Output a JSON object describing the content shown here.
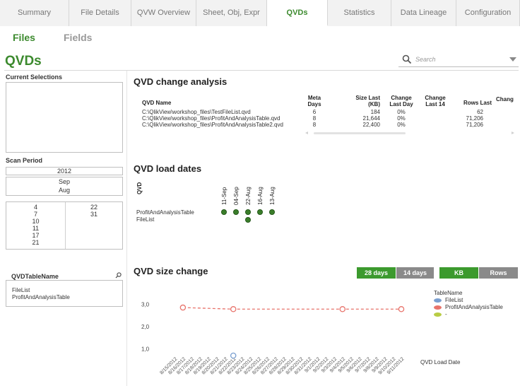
{
  "tabs": [
    {
      "label": "Summary",
      "active": false
    },
    {
      "label": "File Details",
      "active": false
    },
    {
      "label": "QVW Overview",
      "active": false
    },
    {
      "label": "Sheet, Obj, Expr",
      "active": false
    },
    {
      "label": "QVDs",
      "active": true
    },
    {
      "label": "Statistics",
      "active": false
    },
    {
      "label": "Data Lineage",
      "active": false
    },
    {
      "label": "Configuration",
      "active": false
    }
  ],
  "subtabs": [
    {
      "label": "Files",
      "active": true
    },
    {
      "label": "Fields",
      "active": false
    }
  ],
  "page_title": "QVDs",
  "search": {
    "placeholder": "Search",
    "icon": "search-icon"
  },
  "left": {
    "current_selections_label": "Current Selections",
    "scan_period_label": "Scan Period",
    "year": "2012",
    "months": [
      "Sep",
      "Aug"
    ],
    "days_col1": [
      "4",
      "7",
      "10",
      "11",
      "17",
      "21"
    ],
    "days_col2": [
      "22",
      "31"
    ],
    "qvd_table_label": "QVDTableName",
    "qvd_tables": [
      "FileList",
      "ProfitAndAnalysisTable"
    ]
  },
  "change_analysis": {
    "title": "QVD change analysis",
    "headers": {
      "name": "QVD Name",
      "meta_days": "Meta Days",
      "size_last": "Size Last (KB)",
      "change_last_day": "Change Last Day",
      "change_last_14": "Change Last 14",
      "rows_last": "Rows Last",
      "change": "Chang"
    },
    "rows": [
      {
        "name": "C:\\QlikView\\workshop_files\\TestFileList.qvd",
        "meta": "6",
        "size": "184",
        "chg": "0%",
        "rows": "62"
      },
      {
        "name": "C:\\QlikView\\workshop_files\\ProfitAndAnalysisTable.qvd",
        "meta": "8",
        "size": "21,644",
        "chg": "0%",
        "rows": "71,206"
      },
      {
        "name": "C:\\QlikView\\workshop_files\\ProfitAndAnalysisTable2.qvd",
        "meta": "8",
        "size": "22,400",
        "chg": "0%",
        "rows": "71,206"
      }
    ]
  },
  "load_dates": {
    "title": "QVD load dates",
    "qvd_label": "QVD",
    "dates": [
      "11-Sep",
      "04-Sep",
      "22-Aug",
      "16-Aug",
      "13-Aug"
    ],
    "rows": [
      {
        "name": "ProfitAndAnalysisTable",
        "loaded": [
          true,
          true,
          true,
          true,
          true
        ]
      },
      {
        "name": "FileList",
        "loaded": [
          false,
          false,
          true,
          false,
          false
        ]
      }
    ],
    "dot_color": "#3a7d2a"
  },
  "size_change": {
    "title": "QVD size change",
    "buttons": {
      "days28": "28 days",
      "days14": "14 days",
      "kb": "KB",
      "rows": "Rows"
    },
    "legend_title": "TableName",
    "legend": [
      {
        "name": "FileList",
        "color": "#7a9fd0"
      },
      {
        "name": "ProfitAndAnalysisTable",
        "color": "#e8736b"
      },
      {
        "name": "-",
        "color": "#b8cc44"
      }
    ],
    "x_axis_label": "QVD Load Date"
  },
  "chart_data": {
    "type": "line",
    "x": [
      "8/15/2012",
      "8/16/2012",
      "8/17/2012",
      "8/18/2012",
      "8/19/2012",
      "8/20/2012",
      "8/21/2012",
      "8/22/2012",
      "8/23/2012",
      "8/24/2012",
      "8/25/2012",
      "8/26/2012",
      "8/27/2012",
      "8/28/2012",
      "8/29/2012",
      "8/30/2012",
      "8/31/2012",
      "9/1/2012",
      "9/2/2012",
      "9/3/2012",
      "9/4/2012",
      "9/5/2012",
      "9/6/2012",
      "9/7/2012",
      "9/8/2012",
      "9/9/2012",
      "9/10/2012",
      "9/11/2012"
    ],
    "y_ticks": [
      "3,0",
      "2,0",
      "1,0"
    ],
    "ylim": [
      0.7,
      3.2
    ],
    "series": [
      {
        "name": "ProfitAndAnalysisTable",
        "points": [
          {
            "x": "8/16/2012",
            "y": 2.85
          },
          {
            "x": "8/22/2012",
            "y": 2.78
          },
          {
            "x": "9/4/2012",
            "y": 2.78
          },
          {
            "x": "9/11/2012",
            "y": 2.78
          }
        ]
      },
      {
        "name": "FileList",
        "points": [
          {
            "x": "8/22/2012",
            "y": 0.7
          }
        ]
      }
    ],
    "xlabel": "QVD Load Date",
    "legend_title": "TableName"
  }
}
